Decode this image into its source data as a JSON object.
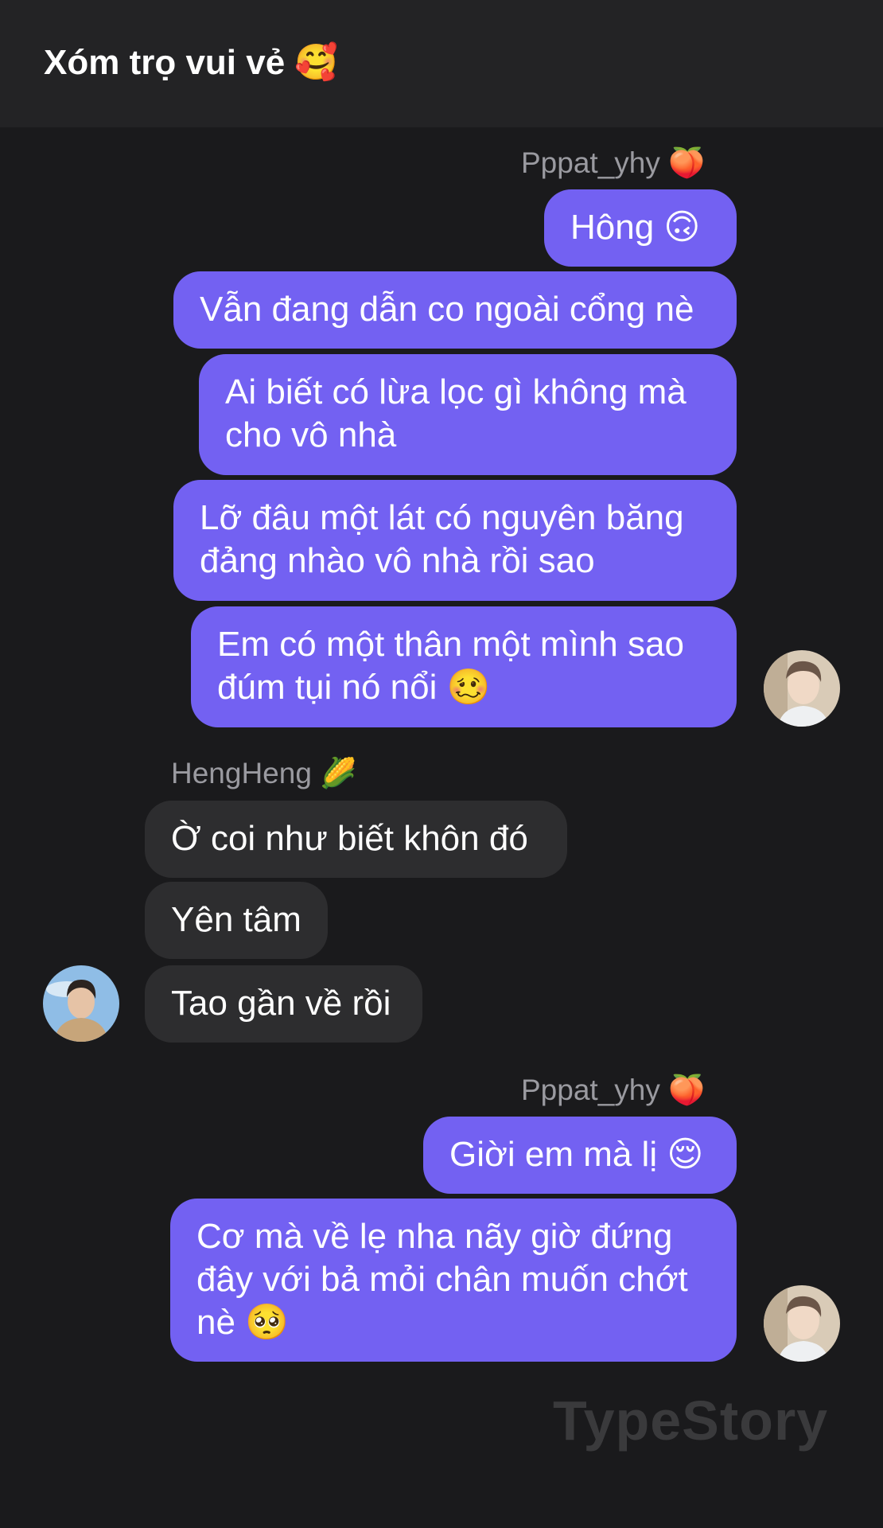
{
  "header": {
    "title": "Xóm trọ vui vẻ",
    "emoji": "🥰"
  },
  "messages": [
    {
      "sender": "Pppat_yhy",
      "sender_emoji": "🍑"
    },
    {
      "text": "Hông",
      "emoji": "🙃"
    },
    {
      "text": "Vẫn đang dẫn co ngoài cổng nè"
    },
    {
      "line1": "Ai biết có lừa lọc gì không mà",
      "line2": "cho vô nhà"
    },
    {
      "line1": "Lỡ đâu một lát có nguyên băng",
      "line2": "đảng nhào vô nhà rồi sao"
    },
    {
      "line1": "Em có một thân một mình sao",
      "line2": "đúm tụi nó nổi",
      "emoji": "🥴"
    },
    {
      "sender": "HengHeng",
      "sender_emoji": "🌽"
    },
    {
      "text": "Ờ coi như biết khôn đó"
    },
    {
      "text": "Yên tâm"
    },
    {
      "text": "Tao gần về rồi"
    },
    {
      "sender": "Pppat_yhy",
      "sender_emoji": "🍑"
    },
    {
      "text": "Giời em mà lị",
      "emoji": "😌"
    },
    {
      "line1": "Cơ mà về lẹ nha nãy giờ đứng",
      "line2": "đây với bả mỏi chân muốn chớt",
      "line3": "nè",
      "emoji": "🥺"
    }
  ],
  "watermark": "TypeStory",
  "colors": {
    "outgoing_bubble": "#7361f2",
    "incoming_bubble": "#2d2d2f",
    "background": "#1a1a1c",
    "header": "#232325"
  }
}
